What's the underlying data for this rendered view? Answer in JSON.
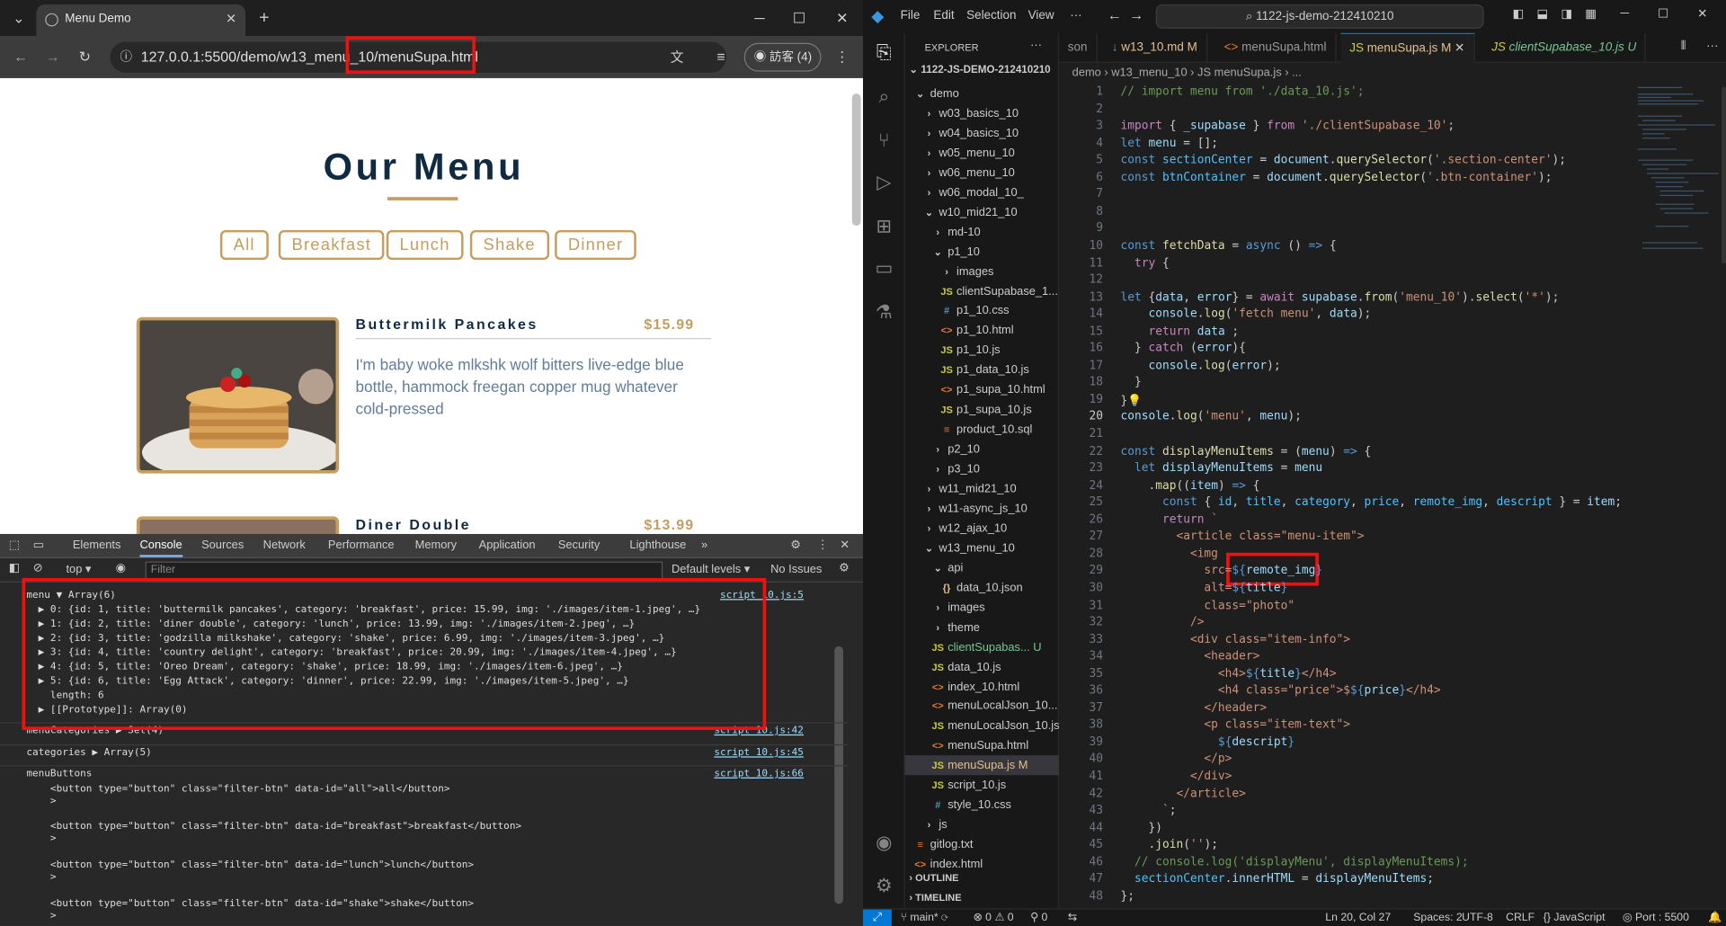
{
  "browser": {
    "tab_title": "Menu Demo",
    "url": "127.0.0.1:5500/demo/w13_menu_10/menuSupa.html",
    "profile": "訪客 (4)",
    "page": {
      "heading": "Our Menu",
      "filters": [
        "All",
        "Breakfast",
        "Lunch",
        "Shake",
        "Dinner"
      ],
      "items": [
        {
          "title": "Buttermilk Pancakes",
          "price": "$15.99",
          "text": "I'm baby woke mlkshk wolf bitters live-edge blue bottle, hammock freegan copper mug whatever cold-pressed"
        },
        {
          "title": "Diner Double",
          "price": "$13.99"
        }
      ]
    },
    "devtools": {
      "tabs": [
        "Elements",
        "Console",
        "Sources",
        "Network",
        "Performance",
        "Memory",
        "Application",
        "Security",
        "Lighthouse"
      ],
      "context": "top",
      "filter_placeholder": "Filter",
      "levels": "Default levels",
      "issues": "No Issues",
      "console": [
        {
          "text": "menu ▼ Array(6)",
          "src": "script_10.js:5"
        },
        {
          "text": "  ▶ 0: {id: 1, title: 'buttermilk pancakes', category: 'breakfast', price: 15.99, img: './images/item-1.jpeg', …}"
        },
        {
          "text": "  ▶ 1: {id: 2, title: 'diner double', category: 'lunch', price: 13.99, img: './images/item-2.jpeg', …}"
        },
        {
          "text": "  ▶ 2: {id: 3, title: 'godzilla milkshake', category: 'shake', price: 6.99, img: './images/item-3.jpeg', …}"
        },
        {
          "text": "  ▶ 3: {id: 4, title: 'country delight', category: 'breakfast', price: 20.99, img: './images/item-4.jpeg', …}"
        },
        {
          "text": "  ▶ 4: {id: 5, title: 'Oreo Dream', category: 'shake', price: 18.99, img: './images/item-6.jpeg', …}"
        },
        {
          "text": "  ▶ 5: {id: 6, title: 'Egg Attack', category: 'dinner', price: 22.99, img: './images/item-5.jpeg', …}"
        },
        {
          "text": "    length: 6"
        },
        {
          "text": "  ▶ [[Prototype]]: Array(0)"
        },
        {
          "text": "menuCategories ▶ Set(4)",
          "src": "script_10.js:42"
        },
        {
          "text": "categories ▶ Array(5)",
          "src": "script_10.js:45"
        },
        {
          "text": "menuButtons",
          "src": "script_10.js:66"
        },
        {
          "text": "    <button type=\"button\" class=\"filter-btn\" data-id=\"all\">all</button>"
        },
        {
          "text": "    >"
        },
        {
          "text": "    <button type=\"button\" class=\"filter-btn\" data-id=\"breakfast\">breakfast</button>"
        },
        {
          "text": "    >"
        },
        {
          "text": "    <button type=\"button\" class=\"filter-btn\" data-id=\"lunch\">lunch</button>"
        },
        {
          "text": "    >"
        },
        {
          "text": "    <button type=\"button\" class=\"filter-btn\" data-id=\"shake\">shake</button>"
        },
        {
          "text": "    >"
        }
      ]
    }
  },
  "vscode": {
    "menu": [
      "File",
      "Edit",
      "Selection",
      "View",
      "···"
    ],
    "command_center": "1122-js-demo-212410210",
    "explorer_title": "EXPLORER",
    "root": "1122-JS-DEMO-212410210",
    "tree": [
      {
        "label": "demo",
        "indent": 1,
        "arrow": "⌄"
      },
      {
        "label": "w03_basics_10",
        "indent": 2,
        "arrow": "›"
      },
      {
        "label": "w04_basics_10",
        "indent": 2,
        "arrow": "›"
      },
      {
        "label": "w05_menu_10",
        "indent": 2,
        "arrow": "›"
      },
      {
        "label": "w06_menu_10",
        "indent": 2,
        "arrow": "›"
      },
      {
        "label": "w06_modal_10_",
        "indent": 2,
        "arrow": "›"
      },
      {
        "label": "w10_mid21_10",
        "indent": 2,
        "arrow": "⌄"
      },
      {
        "label": "md-10",
        "indent": 3,
        "arrow": "›"
      },
      {
        "label": "p1_10",
        "indent": 3,
        "arrow": "⌄"
      },
      {
        "label": "images",
        "indent": 4,
        "arrow": "›"
      },
      {
        "label": "clientSupabase_1...",
        "indent": 4,
        "icon": "JS"
      },
      {
        "label": "p1_10.css",
        "indent": 4,
        "icon": "#"
      },
      {
        "label": "p1_10.html",
        "indent": 4,
        "icon": "<>"
      },
      {
        "label": "p1_10.js",
        "indent": 4,
        "icon": "JS"
      },
      {
        "label": "p1_data_10.js",
        "indent": 4,
        "icon": "JS"
      },
      {
        "label": "p1_supa_10.html",
        "indent": 4,
        "icon": "<>"
      },
      {
        "label": "p1_supa_10.js",
        "indent": 4,
        "icon": "JS"
      },
      {
        "label": "product_10.sql",
        "indent": 4,
        "icon": "≡"
      },
      {
        "label": "p2_10",
        "indent": 3,
        "arrow": "›"
      },
      {
        "label": "p3_10",
        "indent": 3,
        "arrow": "›"
      },
      {
        "label": "w11_mid21_10",
        "indent": 2,
        "arrow": "›"
      },
      {
        "label": "w11-async_js_10",
        "indent": 2,
        "arrow": "›"
      },
      {
        "label": "w12_ajax_10",
        "indent": 2,
        "arrow": "›"
      },
      {
        "label": "w13_menu_10",
        "indent": 2,
        "arrow": "⌄"
      },
      {
        "label": "api",
        "indent": 3,
        "arrow": "⌄"
      },
      {
        "label": "data_10.json",
        "indent": 4,
        "icon": "{}"
      },
      {
        "label": "images",
        "indent": 3,
        "arrow": "›"
      },
      {
        "label": "theme",
        "indent": 3,
        "arrow": "›"
      },
      {
        "label": "clientSupabas... U",
        "indent": 3,
        "icon": "JS"
      },
      {
        "label": "data_10.js",
        "indent": 3,
        "icon": "JS"
      },
      {
        "label": "index_10.html",
        "indent": 3,
        "icon": "<>"
      },
      {
        "label": "menuLocalJson_10...",
        "indent": 3,
        "icon": "<>"
      },
      {
        "label": "menuLocalJson_10.js",
        "indent": 3,
        "icon": "JS"
      },
      {
        "label": "menuSupa.html",
        "indent": 3,
        "icon": "<>"
      },
      {
        "label": "menuSupa.js      M",
        "indent": 3,
        "icon": "JS"
      },
      {
        "label": "script_10.js",
        "indent": 3,
        "icon": "JS"
      },
      {
        "label": "style_10.css",
        "indent": 3,
        "icon": "#"
      },
      {
        "label": "js",
        "indent": 2,
        "arrow": "›"
      },
      {
        "label": "gitlog.txt",
        "indent": 1,
        "icon": "≡"
      },
      {
        "label": "index.html",
        "indent": 1,
        "icon": "<>"
      }
    ],
    "outline": "OUTLINE",
    "timeline": "TIMELINE",
    "tabs": [
      "son",
      "w13_10.md M",
      "menuSupa.html",
      "menuSupa.js M",
      "clientSupabase_10.js U"
    ],
    "breadcrumb": "demo › w13_menu_10 › JS menuSupa.js › ...",
    "status": {
      "branch": "main*",
      "errors": "⊗ 0 ⚠ 0",
      "ports": "⚲ 0",
      "position": "Ln 20, Col 27",
      "spaces": "Spaces: 2",
      "encoding": "UTF-8",
      "eol": "CRLF",
      "lang": "{} JavaScript",
      "port": "Port : 5500"
    }
  }
}
